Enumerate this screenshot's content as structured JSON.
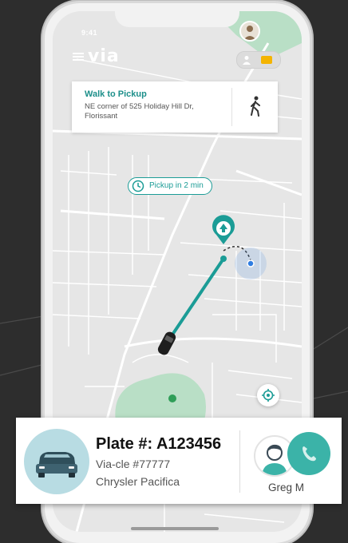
{
  "status_bar": {
    "time": "9:41"
  },
  "header": {
    "logo": "via",
    "menu_icon": "hamburger-menu-icon",
    "payment_card_color": "#f4b400"
  },
  "walk_card": {
    "title": "Walk to Pickup",
    "address": "NE corner of 525 Holiday Hill Dr, Florissant",
    "icon": "walking-person-icon"
  },
  "map": {
    "pickup_chip": "Pickup in 2 min",
    "route_color": "#1b9c96",
    "green_area_color": "#b9dfc6",
    "user_dot_color": "#2f7de1"
  },
  "ride": {
    "plate": "Plate #: A123456",
    "via_code": "Via-cle #77777",
    "vehicle": "Chrysler Pacifica",
    "driver": "Greg M",
    "call_button_color": "#3bb3a8"
  }
}
